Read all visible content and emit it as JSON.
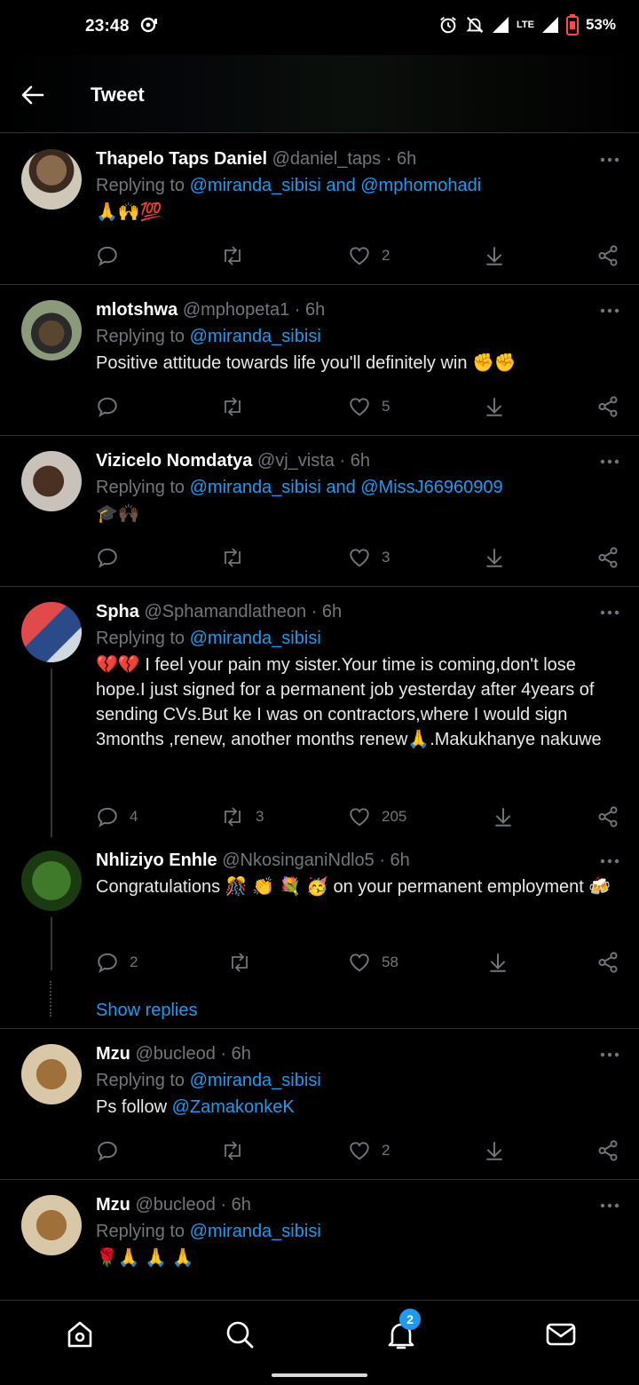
{
  "status": {
    "time": "23:48",
    "network": "LTE",
    "battery": "53%"
  },
  "header": {
    "title": "Tweet"
  },
  "tweets": [
    {
      "name": "Thapelo Taps Daniel",
      "handle": "@daniel_taps",
      "time": "6h",
      "reply_prefix": "Replying to",
      "reply_to": "@miranda_sibisi and @mphomohadi",
      "text": "🙏🙌💯",
      "replies": "",
      "retweets": "",
      "likes": "2"
    },
    {
      "name": "mlotshwa",
      "handle": "@mphopeta1",
      "time": "6h",
      "reply_prefix": "Replying to",
      "reply_to": "@miranda_sibisi",
      "text": "Positive attitude towards life you'll definitely win ✊✊",
      "replies": "",
      "retweets": "",
      "likes": "5"
    },
    {
      "name": "Vizicelo Nomdatya",
      "handle": "@vj_vista",
      "time": "6h",
      "reply_prefix": "Replying to",
      "reply_to": "@miranda_sibisi and @MissJ66960909",
      "text": "🎓🙌🏿",
      "replies": "",
      "retweets": "",
      "likes": "3"
    },
    {
      "name": "Spha",
      "handle": "@Sphamandlatheon",
      "time": "6h",
      "reply_prefix": "Replying to",
      "reply_to": "@miranda_sibisi",
      "text": "💔💔 I feel your pain my sister.Your time is coming,don't lose hope.I just signed for a permanent job yesterday after 4years of sending CVs.But ke I was on contractors,where I would sign 3months ,renew, another months renew🙏.Makukhanye nakuwe",
      "replies": "4",
      "retweets": "3",
      "likes": "205"
    },
    {
      "name": "Nhliziyo Enhle",
      "handle": "@NkosinganiNdlo5",
      "time": "6h",
      "reply_prefix": "",
      "reply_to": "",
      "text": "Congratulations 🎊 👏 💐 🥳 on your permanent employment 🍻",
      "replies": "2",
      "retweets": "",
      "likes": "58"
    },
    {
      "name": "Mzu",
      "handle": "@bucleod",
      "time": "6h",
      "reply_prefix": "Replying to",
      "reply_to": "@miranda_sibisi",
      "text_prefix": "Ps follow ",
      "text_link": "@ZamakonkeK",
      "replies": "",
      "retweets": "",
      "likes": "2"
    },
    {
      "name": "Mzu",
      "handle": "@bucleod",
      "time": "6h",
      "reply_prefix": "Replying to",
      "reply_to": "@miranda_sibisi",
      "text": "🌹🙏 🙏 🙏",
      "replies": "",
      "retweets": "",
      "likes": ""
    }
  ],
  "show_replies": "Show replies",
  "nav": {
    "notification_count": "2"
  },
  "colors": {
    "background": "#000000",
    "link": "#1d9bf0",
    "secondary_text": "#71767b",
    "divider": "#2f3336"
  }
}
